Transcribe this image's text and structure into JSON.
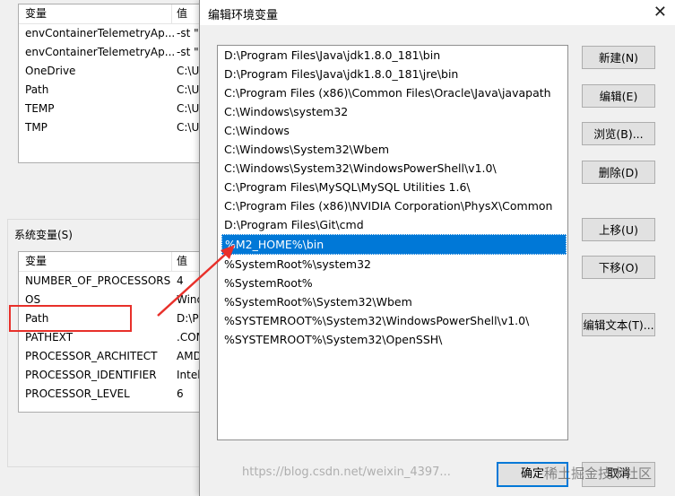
{
  "user_vars": {
    "header": {
      "name": "变量",
      "value": "值"
    },
    "rows": [
      {
        "name": "envContainerTelemetryAp...",
        "value": "-st \"("
      },
      {
        "name": "envContainerTelemetryAp...",
        "value": "-st \"("
      },
      {
        "name": "OneDrive",
        "value": "C:\\U"
      },
      {
        "name": "Path",
        "value": "C:\\U"
      },
      {
        "name": "TEMP",
        "value": "C:\\U"
      },
      {
        "name": "TMP",
        "value": "C:\\U"
      }
    ]
  },
  "system_vars": {
    "group_label": "系统变量(S)",
    "header": {
      "name": "变量",
      "value": "值"
    },
    "rows": [
      {
        "name": "NUMBER_OF_PROCESSORS",
        "value": "4"
      },
      {
        "name": "OS",
        "value": "Wind"
      },
      {
        "name": "Path",
        "value": "D:\\Pr"
      },
      {
        "name": "PATHEXT",
        "value": ".COM"
      },
      {
        "name": "PROCESSOR_ARCHITECT",
        "value": "AMD"
      },
      {
        "name": "PROCESSOR_IDENTIFIER",
        "value": "Intel"
      },
      {
        "name": "PROCESSOR_LEVEL",
        "value": "6"
      }
    ]
  },
  "dialog": {
    "title": "编辑环境变量",
    "close": "✕",
    "paths": [
      "D:\\Program Files\\Java\\jdk1.8.0_181\\bin",
      "D:\\Program Files\\Java\\jdk1.8.0_181\\jre\\bin",
      "C:\\Program Files (x86)\\Common Files\\Oracle\\Java\\javapath",
      "C:\\Windows\\system32",
      "C:\\Windows",
      "C:\\Windows\\System32\\Wbem",
      "C:\\Windows\\System32\\WindowsPowerShell\\v1.0\\",
      "C:\\Program Files\\MySQL\\MySQL Utilities 1.6\\",
      "C:\\Program Files (x86)\\NVIDIA Corporation\\PhysX\\Common",
      "D:\\Program Files\\Git\\cmd",
      "%M2_HOME%\\bin",
      "%SystemRoot%\\system32",
      "%SystemRoot%",
      "%SystemRoot%\\System32\\Wbem",
      "%SYSTEMROOT%\\System32\\WindowsPowerShell\\v1.0\\",
      "%SYSTEMROOT%\\System32\\OpenSSH\\"
    ],
    "selected_index": 10,
    "buttons": {
      "new": "新建(N)",
      "edit": "编辑(E)",
      "browse": "浏览(B)...",
      "delete": "删除(D)",
      "move_up": "上移(U)",
      "move_down": "下移(O)",
      "edit_text": "编辑文本(T)...",
      "ok": "确定",
      "cancel": "取消"
    }
  },
  "watermark": "https://blog.csdn.net/weixin_4397...",
  "watermark2": "稀土掘金技术社区",
  "colors": {
    "selection": "#0078d7",
    "highlight": "#e8302a"
  }
}
